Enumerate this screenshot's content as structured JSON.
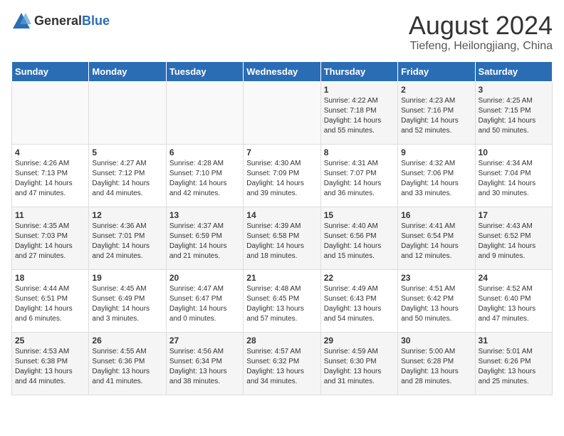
{
  "header": {
    "logo_general": "General",
    "logo_blue": "Blue",
    "month_year": "August 2024",
    "location": "Tiefeng, Heilongjiang, China"
  },
  "days_of_week": [
    "Sunday",
    "Monday",
    "Tuesday",
    "Wednesday",
    "Thursday",
    "Friday",
    "Saturday"
  ],
  "weeks": [
    [
      {
        "day": "",
        "info": ""
      },
      {
        "day": "",
        "info": ""
      },
      {
        "day": "",
        "info": ""
      },
      {
        "day": "",
        "info": ""
      },
      {
        "day": "1",
        "info": "Sunrise: 4:22 AM\nSunset: 7:18 PM\nDaylight: 14 hours\nand 55 minutes."
      },
      {
        "day": "2",
        "info": "Sunrise: 4:23 AM\nSunset: 7:16 PM\nDaylight: 14 hours\nand 52 minutes."
      },
      {
        "day": "3",
        "info": "Sunrise: 4:25 AM\nSunset: 7:15 PM\nDaylight: 14 hours\nand 50 minutes."
      }
    ],
    [
      {
        "day": "4",
        "info": "Sunrise: 4:26 AM\nSunset: 7:13 PM\nDaylight: 14 hours\nand 47 minutes."
      },
      {
        "day": "5",
        "info": "Sunrise: 4:27 AM\nSunset: 7:12 PM\nDaylight: 14 hours\nand 44 minutes."
      },
      {
        "day": "6",
        "info": "Sunrise: 4:28 AM\nSunset: 7:10 PM\nDaylight: 14 hours\nand 42 minutes."
      },
      {
        "day": "7",
        "info": "Sunrise: 4:30 AM\nSunset: 7:09 PM\nDaylight: 14 hours\nand 39 minutes."
      },
      {
        "day": "8",
        "info": "Sunrise: 4:31 AM\nSunset: 7:07 PM\nDaylight: 14 hours\nand 36 minutes."
      },
      {
        "day": "9",
        "info": "Sunrise: 4:32 AM\nSunset: 7:06 PM\nDaylight: 14 hours\nand 33 minutes."
      },
      {
        "day": "10",
        "info": "Sunrise: 4:34 AM\nSunset: 7:04 PM\nDaylight: 14 hours\nand 30 minutes."
      }
    ],
    [
      {
        "day": "11",
        "info": "Sunrise: 4:35 AM\nSunset: 7:03 PM\nDaylight: 14 hours\nand 27 minutes."
      },
      {
        "day": "12",
        "info": "Sunrise: 4:36 AM\nSunset: 7:01 PM\nDaylight: 14 hours\nand 24 minutes."
      },
      {
        "day": "13",
        "info": "Sunrise: 4:37 AM\nSunset: 6:59 PM\nDaylight: 14 hours\nand 21 minutes."
      },
      {
        "day": "14",
        "info": "Sunrise: 4:39 AM\nSunset: 6:58 PM\nDaylight: 14 hours\nand 18 minutes."
      },
      {
        "day": "15",
        "info": "Sunrise: 4:40 AM\nSunset: 6:56 PM\nDaylight: 14 hours\nand 15 minutes."
      },
      {
        "day": "16",
        "info": "Sunrise: 4:41 AM\nSunset: 6:54 PM\nDaylight: 14 hours\nand 12 minutes."
      },
      {
        "day": "17",
        "info": "Sunrise: 4:43 AM\nSunset: 6:52 PM\nDaylight: 14 hours\nand 9 minutes."
      }
    ],
    [
      {
        "day": "18",
        "info": "Sunrise: 4:44 AM\nSunset: 6:51 PM\nDaylight: 14 hours\nand 6 minutes."
      },
      {
        "day": "19",
        "info": "Sunrise: 4:45 AM\nSunset: 6:49 PM\nDaylight: 14 hours\nand 3 minutes."
      },
      {
        "day": "20",
        "info": "Sunrise: 4:47 AM\nSunset: 6:47 PM\nDaylight: 14 hours\nand 0 minutes."
      },
      {
        "day": "21",
        "info": "Sunrise: 4:48 AM\nSunset: 6:45 PM\nDaylight: 13 hours\nand 57 minutes."
      },
      {
        "day": "22",
        "info": "Sunrise: 4:49 AM\nSunset: 6:43 PM\nDaylight: 13 hours\nand 54 minutes."
      },
      {
        "day": "23",
        "info": "Sunrise: 4:51 AM\nSunset: 6:42 PM\nDaylight: 13 hours\nand 50 minutes."
      },
      {
        "day": "24",
        "info": "Sunrise: 4:52 AM\nSunset: 6:40 PM\nDaylight: 13 hours\nand 47 minutes."
      }
    ],
    [
      {
        "day": "25",
        "info": "Sunrise: 4:53 AM\nSunset: 6:38 PM\nDaylight: 13 hours\nand 44 minutes."
      },
      {
        "day": "26",
        "info": "Sunrise: 4:55 AM\nSunset: 6:36 PM\nDaylight: 13 hours\nand 41 minutes."
      },
      {
        "day": "27",
        "info": "Sunrise: 4:56 AM\nSunset: 6:34 PM\nDaylight: 13 hours\nand 38 minutes."
      },
      {
        "day": "28",
        "info": "Sunrise: 4:57 AM\nSunset: 6:32 PM\nDaylight: 13 hours\nand 34 minutes."
      },
      {
        "day": "29",
        "info": "Sunrise: 4:59 AM\nSunset: 6:30 PM\nDaylight: 13 hours\nand 31 minutes."
      },
      {
        "day": "30",
        "info": "Sunrise: 5:00 AM\nSunset: 6:28 PM\nDaylight: 13 hours\nand 28 minutes."
      },
      {
        "day": "31",
        "info": "Sunrise: 5:01 AM\nSunset: 6:26 PM\nDaylight: 13 hours\nand 25 minutes."
      }
    ]
  ]
}
